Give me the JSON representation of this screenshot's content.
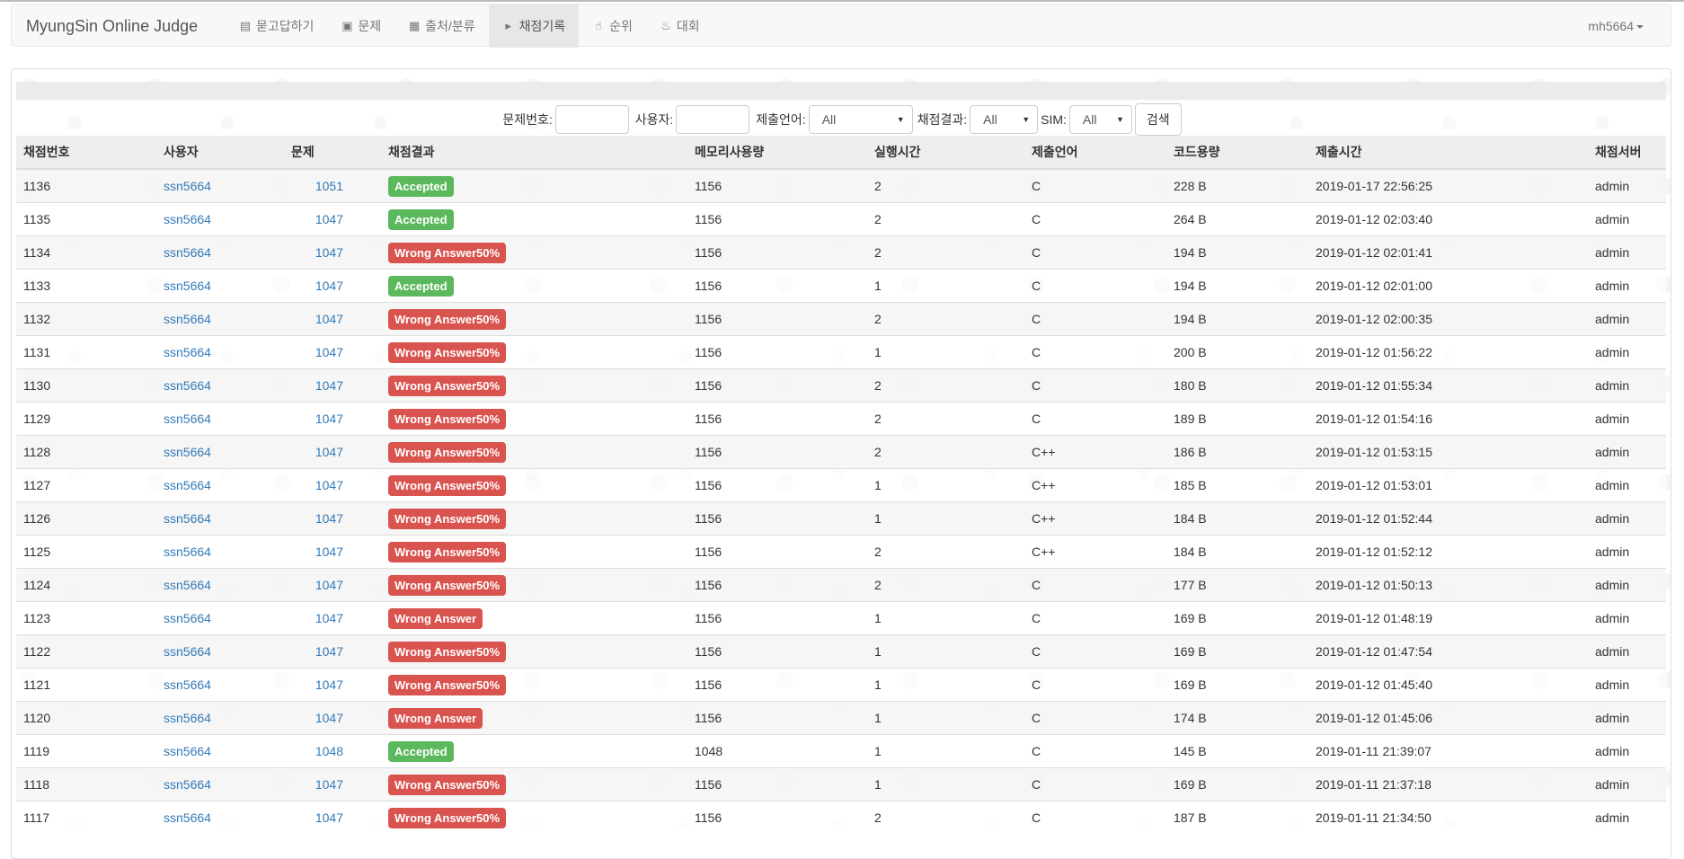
{
  "brand": "MyungSin Online Judge",
  "nav": [
    {
      "label": "묻고답하기",
      "icon": "book-icon"
    },
    {
      "label": "문제",
      "icon": "notebook-icon"
    },
    {
      "label": "출처/분류",
      "icon": "grid-icon"
    },
    {
      "label": "채점기록",
      "icon": "play-circle-icon",
      "active": true
    },
    {
      "label": "순위",
      "icon": "thumbs-up-icon"
    },
    {
      "label": "대회",
      "icon": "fire-icon"
    }
  ],
  "user": "mh5664",
  "search": {
    "problem_label": "문제번호:",
    "problem_value": "",
    "user_label": "사용자:",
    "user_value": "",
    "language_label": "제출언어:",
    "language_value": "All",
    "result_label": "채점결과:",
    "result_value": "All",
    "sim_label": "SIM:",
    "sim_value": "All",
    "button": "검색"
  },
  "columns": [
    "채점번호",
    "사용자",
    "문제",
    "채점결과",
    "메모리사용량",
    "실행시간",
    "제출언어",
    "코드용량",
    "제출시간",
    "채점서버"
  ],
  "colors": {
    "accepted": "#5cb85c",
    "wrong": "#d9534f",
    "link": "#337ab7"
  },
  "rows": [
    {
      "id": "1136",
      "user": "ssn5664",
      "problem": "1051",
      "result": "Accepted",
      "status": "ok",
      "memory": "1156",
      "time": "2",
      "lang": "C",
      "size": "228 B",
      "submitted": "2019-01-17 22:56:25",
      "server": "admin"
    },
    {
      "id": "1135",
      "user": "ssn5664",
      "problem": "1047",
      "result": "Accepted",
      "status": "ok",
      "memory": "1156",
      "time": "2",
      "lang": "C",
      "size": "264 B",
      "submitted": "2019-01-12 02:03:40",
      "server": "admin"
    },
    {
      "id": "1134",
      "user": "ssn5664",
      "problem": "1047",
      "result": "Wrong Answer50%",
      "status": "err",
      "memory": "1156",
      "time": "2",
      "lang": "C",
      "size": "194 B",
      "submitted": "2019-01-12 02:01:41",
      "server": "admin"
    },
    {
      "id": "1133",
      "user": "ssn5664",
      "problem": "1047",
      "result": "Accepted",
      "status": "ok",
      "memory": "1156",
      "time": "1",
      "lang": "C",
      "size": "194 B",
      "submitted": "2019-01-12 02:01:00",
      "server": "admin"
    },
    {
      "id": "1132",
      "user": "ssn5664",
      "problem": "1047",
      "result": "Wrong Answer50%",
      "status": "err",
      "memory": "1156",
      "time": "2",
      "lang": "C",
      "size": "194 B",
      "submitted": "2019-01-12 02:00:35",
      "server": "admin"
    },
    {
      "id": "1131",
      "user": "ssn5664",
      "problem": "1047",
      "result": "Wrong Answer50%",
      "status": "err",
      "memory": "1156",
      "time": "1",
      "lang": "C",
      "size": "200 B",
      "submitted": "2019-01-12 01:56:22",
      "server": "admin"
    },
    {
      "id": "1130",
      "user": "ssn5664",
      "problem": "1047",
      "result": "Wrong Answer50%",
      "status": "err",
      "memory": "1156",
      "time": "2",
      "lang": "C",
      "size": "180 B",
      "submitted": "2019-01-12 01:55:34",
      "server": "admin"
    },
    {
      "id": "1129",
      "user": "ssn5664",
      "problem": "1047",
      "result": "Wrong Answer50%",
      "status": "err",
      "memory": "1156",
      "time": "2",
      "lang": "C",
      "size": "189 B",
      "submitted": "2019-01-12 01:54:16",
      "server": "admin"
    },
    {
      "id": "1128",
      "user": "ssn5664",
      "problem": "1047",
      "result": "Wrong Answer50%",
      "status": "err",
      "memory": "1156",
      "time": "2",
      "lang": "C++",
      "size": "186 B",
      "submitted": "2019-01-12 01:53:15",
      "server": "admin"
    },
    {
      "id": "1127",
      "user": "ssn5664",
      "problem": "1047",
      "result": "Wrong Answer50%",
      "status": "err",
      "memory": "1156",
      "time": "1",
      "lang": "C++",
      "size": "185 B",
      "submitted": "2019-01-12 01:53:01",
      "server": "admin"
    },
    {
      "id": "1126",
      "user": "ssn5664",
      "problem": "1047",
      "result": "Wrong Answer50%",
      "status": "err",
      "memory": "1156",
      "time": "1",
      "lang": "C++",
      "size": "184 B",
      "submitted": "2019-01-12 01:52:44",
      "server": "admin"
    },
    {
      "id": "1125",
      "user": "ssn5664",
      "problem": "1047",
      "result": "Wrong Answer50%",
      "status": "err",
      "memory": "1156",
      "time": "2",
      "lang": "C++",
      "size": "184 B",
      "submitted": "2019-01-12 01:52:12",
      "server": "admin"
    },
    {
      "id": "1124",
      "user": "ssn5664",
      "problem": "1047",
      "result": "Wrong Answer50%",
      "status": "err",
      "memory": "1156",
      "time": "2",
      "lang": "C",
      "size": "177 B",
      "submitted": "2019-01-12 01:50:13",
      "server": "admin"
    },
    {
      "id": "1123",
      "user": "ssn5664",
      "problem": "1047",
      "result": "Wrong Answer",
      "status": "err",
      "memory": "1156",
      "time": "1",
      "lang": "C",
      "size": "169 B",
      "submitted": "2019-01-12 01:48:19",
      "server": "admin"
    },
    {
      "id": "1122",
      "user": "ssn5664",
      "problem": "1047",
      "result": "Wrong Answer50%",
      "status": "err",
      "memory": "1156",
      "time": "1",
      "lang": "C",
      "size": "169 B",
      "submitted": "2019-01-12 01:47:54",
      "server": "admin"
    },
    {
      "id": "1121",
      "user": "ssn5664",
      "problem": "1047",
      "result": "Wrong Answer50%",
      "status": "err",
      "memory": "1156",
      "time": "1",
      "lang": "C",
      "size": "169 B",
      "submitted": "2019-01-12 01:45:40",
      "server": "admin"
    },
    {
      "id": "1120",
      "user": "ssn5664",
      "problem": "1047",
      "result": "Wrong Answer",
      "status": "err",
      "memory": "1156",
      "time": "1",
      "lang": "C",
      "size": "174 B",
      "submitted": "2019-01-12 01:45:06",
      "server": "admin"
    },
    {
      "id": "1119",
      "user": "ssn5664",
      "problem": "1048",
      "result": "Accepted",
      "status": "ok",
      "memory": "1048",
      "time": "1",
      "lang": "C",
      "size": "145 B",
      "submitted": "2019-01-11 21:39:07",
      "server": "admin"
    },
    {
      "id": "1118",
      "user": "ssn5664",
      "problem": "1047",
      "result": "Wrong Answer50%",
      "status": "err",
      "memory": "1156",
      "time": "1",
      "lang": "C",
      "size": "169 B",
      "submitted": "2019-01-11 21:37:18",
      "server": "admin"
    },
    {
      "id": "1117",
      "user": "ssn5664",
      "problem": "1047",
      "result": "Wrong Answer50%",
      "status": "err",
      "memory": "1156",
      "time": "2",
      "lang": "C",
      "size": "187 B",
      "submitted": "2019-01-11 21:34:50",
      "server": "admin"
    }
  ]
}
